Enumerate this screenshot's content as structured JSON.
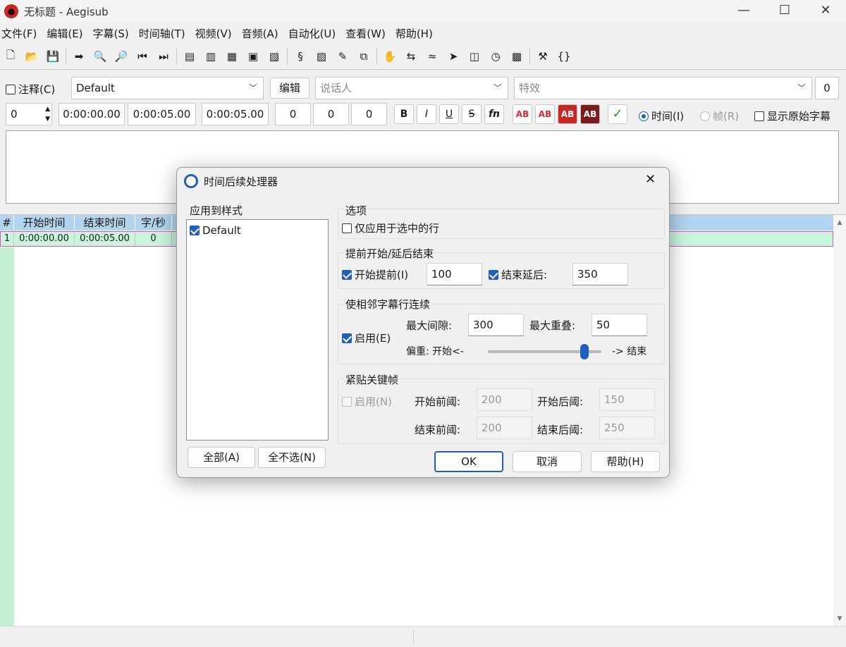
{
  "window": {
    "title": "无标题 - Aegisub",
    "minimize": "—",
    "maximize": "☐",
    "close": "✕"
  },
  "menu": [
    "文件(F)",
    "编辑(E)",
    "字幕(S)",
    "时间轴(T)",
    "视频(V)",
    "音频(A)",
    "自动化(U)",
    "查看(W)",
    "帮助(H)"
  ],
  "toolbar_icons": [
    "new-file-icon",
    "open-file-icon",
    "save-icon",
    "sep",
    "jump-to-icon",
    "zoom-in-icon",
    "zoom-out-icon",
    "video-snap-start-icon",
    "video-snap-end-icon",
    "sep",
    "styles-manager-icon",
    "attachments-icon",
    "fonts-collector-icon",
    "resolution-icon",
    "properties-icon",
    "sep",
    "automation-icon",
    "spell-check-icon",
    "translation-icon",
    "kanji-timer-icon",
    "sep",
    "timing-postprocessor-icon",
    "shift-times-icon",
    "select-lines-icon",
    "resample-icon",
    "timer-icon",
    "styling-assistant-icon",
    "subtitle-check-icon",
    "sep",
    "options-icon",
    "tags-icon"
  ],
  "edit": {
    "comment_label": "注释(C)",
    "style_value": "Default",
    "edit_button": "编辑",
    "actor_placeholder": "说话人",
    "effect_placeholder": "特效",
    "layer_right": "0",
    "layer": "0",
    "start_time": "0:00:00.00",
    "end_time": "0:00:05.00",
    "duration": "0:00:05.00",
    "margin_l": "0",
    "margin_r": "0",
    "margin_v": "0",
    "bold": "B",
    "italic": "I",
    "underline": "U",
    "strike": "S",
    "font": "fn",
    "color_labels": [
      "AB",
      "AB",
      "AB",
      "AB"
    ],
    "commit": "✓",
    "time_label": "时间(I)",
    "frame_label": "帧(R)",
    "show_original_label": "显示原始字幕"
  },
  "grid": {
    "headers": [
      "#",
      "开始时间",
      "结束时间",
      "字/秒"
    ],
    "rows": [
      {
        "num": "1",
        "start": "0:00:00.00",
        "end": "0:00:05.00",
        "cps": "0"
      }
    ]
  },
  "dialog": {
    "title": "时间后续处理器",
    "close": "✕",
    "styles_group": "应用到样式",
    "styles": [
      "Default"
    ],
    "select_all": "全部(A)",
    "select_none": "全不选(N)",
    "options_group": "选项",
    "only_selected": "仅应用于选中的行",
    "lead_group": "提前开始/延后结束",
    "lead_in_label": "开始提前(I)",
    "lead_in_value": "100",
    "lead_out_label": "结束延后:",
    "lead_out_value": "350",
    "adjacent_group": "使相邻字幕行连续",
    "adjacent_enable": "启用(E)",
    "max_gap_label": "最大间隙:",
    "max_gap_value": "300",
    "max_overlap_label": "最大重叠:",
    "max_overlap_value": "50",
    "bias_label": "偏重: 开始<-",
    "bias_end": "-> 结束",
    "bias_fraction": 0.85,
    "keyframe_group": "紧贴关键帧",
    "keyframe_enable": "启用(N)",
    "kf_before_start_label": "开始前阈:",
    "kf_before_start_value": "200",
    "kf_after_start_label": "开始后阈:",
    "kf_after_start_value": "150",
    "kf_before_end_label": "结束前阈:",
    "kf_before_end_value": "200",
    "kf_after_end_label": "结束后阈:",
    "kf_after_end_value": "250",
    "ok": "OK",
    "cancel": "取消",
    "help": "帮助(H)"
  },
  "colors": {
    "accent": "#1f5fbf",
    "grid_header": "#b3d4ef",
    "row_fill": "#c8f5dc",
    "row_border": "#e04fcf"
  }
}
